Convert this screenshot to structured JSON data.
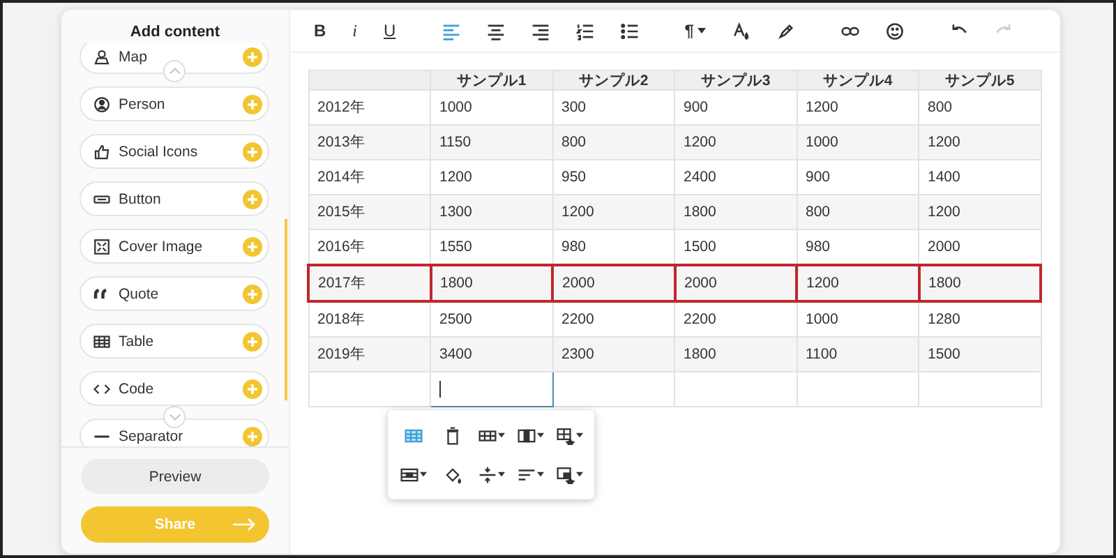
{
  "sidebar": {
    "title": "Add content",
    "items": [
      {
        "kind": "map",
        "label": "Map"
      },
      {
        "kind": "person",
        "label": "Person"
      },
      {
        "kind": "social",
        "label": "Social Icons"
      },
      {
        "kind": "button",
        "label": "Button"
      },
      {
        "kind": "cover",
        "label": "Cover Image"
      },
      {
        "kind": "quote",
        "label": "Quote"
      },
      {
        "kind": "table",
        "label": "Table"
      },
      {
        "kind": "code",
        "label": "Code"
      },
      {
        "kind": "separator",
        "label": "Separator"
      }
    ],
    "preview": "Preview",
    "share": "Share"
  },
  "toolbar": [
    {
      "tools": [
        {
          "kind": "bold",
          "label": "B",
          "active": false,
          "disabled": false
        },
        {
          "kind": "italic",
          "label": "i",
          "active": false,
          "disabled": false
        },
        {
          "kind": "underline",
          "label": "U",
          "active": false,
          "disabled": false
        }
      ]
    },
    {
      "tools": [
        {
          "kind": "align-left",
          "active": true,
          "disabled": false
        },
        {
          "kind": "align-center",
          "active": false,
          "disabled": false
        },
        {
          "kind": "align-right",
          "active": false,
          "disabled": false
        },
        {
          "kind": "ordered-list",
          "active": false,
          "disabled": false
        },
        {
          "kind": "bullet-list",
          "active": false,
          "disabled": false
        }
      ]
    },
    {
      "tools": [
        {
          "kind": "paragraph",
          "label": "¶",
          "active": false,
          "disabled": false
        },
        {
          "kind": "text-color",
          "active": false,
          "disabled": false
        },
        {
          "kind": "highlight",
          "active": false,
          "disabled": false
        }
      ]
    },
    {
      "tools": [
        {
          "kind": "link",
          "active": false,
          "disabled": false
        },
        {
          "kind": "emoji",
          "active": false,
          "disabled": false
        }
      ]
    },
    {
      "tools": [
        {
          "kind": "undo",
          "active": false,
          "disabled": false
        },
        {
          "kind": "redo",
          "active": false,
          "disabled": true
        }
      ]
    }
  ],
  "table": {
    "columns": [
      "サンプル1",
      "サンプル2",
      "サンプル3",
      "サンプル4",
      "サンプル5"
    ],
    "rows": [
      {
        "year": "2012年",
        "cells": [
          "1000",
          "300",
          "900",
          "1200",
          "800"
        ],
        "selected": false
      },
      {
        "year": "2013年",
        "cells": [
          "1150",
          "800",
          "1200",
          "1000",
          "1200"
        ],
        "selected": false
      },
      {
        "year": "2014年",
        "cells": [
          "1200",
          "950",
          "2400",
          "900",
          "1400"
        ],
        "selected": false
      },
      {
        "year": "2015年",
        "cells": [
          "1300",
          "1200",
          "1800",
          "800",
          "1200"
        ],
        "selected": false
      },
      {
        "year": "2016年",
        "cells": [
          "1550",
          "980",
          "1500",
          "980",
          "2000"
        ],
        "selected": false
      },
      {
        "year": "2017年",
        "cells": [
          "1800",
          "2000",
          "2000",
          "1200",
          "1800"
        ],
        "selected": true
      },
      {
        "year": "2018年",
        "cells": [
          "2500",
          "2200",
          "2200",
          "1000",
          "1280"
        ],
        "selected": false
      },
      {
        "year": "2019年",
        "cells": [
          "3400",
          "2300",
          "1800",
          "1100",
          "1500"
        ],
        "selected": false
      }
    ],
    "new_row": [
      {
        "focused": false
      },
      {
        "focused": true
      },
      {
        "focused": false
      },
      {
        "focused": false
      },
      {
        "focused": false
      },
      {
        "focused": false
      }
    ]
  },
  "cell_menu": [
    {
      "kind": "table",
      "active": true,
      "dropdown": false
    },
    {
      "kind": "delete",
      "active": false,
      "dropdown": false
    },
    {
      "kind": "rows",
      "active": false,
      "dropdown": true
    },
    {
      "kind": "columns",
      "active": false,
      "dropdown": true
    },
    {
      "kind": "table-style",
      "active": false,
      "dropdown": true
    },
    {
      "kind": "cell",
      "active": false,
      "dropdown": true
    },
    {
      "kind": "fill",
      "active": false,
      "dropdown": false
    },
    {
      "kind": "valign",
      "active": false,
      "dropdown": true
    },
    {
      "kind": "halign",
      "active": false,
      "dropdown": true
    },
    {
      "kind": "cell-style",
      "active": false,
      "dropdown": true
    }
  ]
}
